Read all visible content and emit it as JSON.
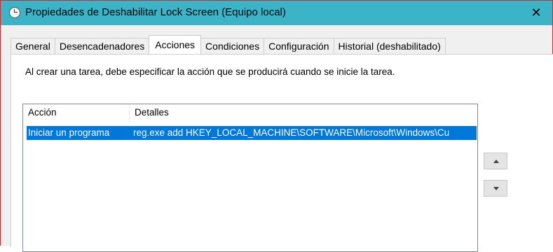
{
  "window": {
    "title": "Propiedades de Deshabilitar Lock Screen (Equipo local)",
    "close_glyph": "✕",
    "icon": "clock-icon"
  },
  "tabs": [
    {
      "label": "General",
      "active": false
    },
    {
      "label": "Desencadenadores",
      "active": false
    },
    {
      "label": "Acciones",
      "active": true
    },
    {
      "label": "Condiciones",
      "active": false
    },
    {
      "label": "Configuración",
      "active": false
    },
    {
      "label": "Historial (deshabilitado)",
      "active": false
    }
  ],
  "actions_tab": {
    "instructions": "Al crear una tarea, debe especificar la acción que se producirá cuando se inicie la tarea.",
    "columns": [
      "Acción",
      "Detalles"
    ],
    "rows": [
      {
        "action": "Iniciar un programa",
        "details": "reg.exe add  HKEY_LOCAL_MACHINE\\SOFTWARE\\Microsoft\\Windows\\Cu",
        "selected": true
      }
    ],
    "move_up_icon": "triangle-up-icon",
    "move_down_icon": "triangle-down-icon"
  },
  "colors": {
    "titlebar": "#3cb4c8",
    "selection": "#0078d7",
    "window_border": "#c03030"
  }
}
